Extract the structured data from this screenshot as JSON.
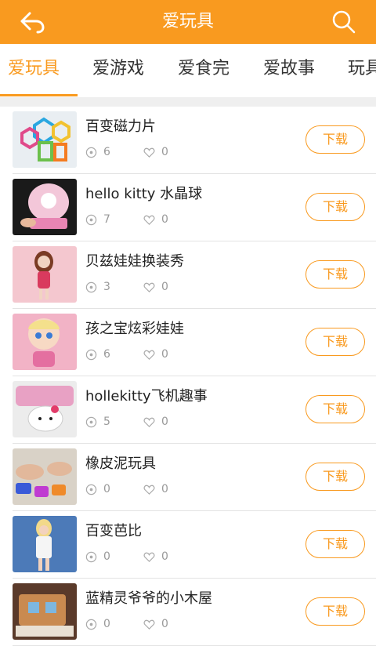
{
  "header": {
    "title": "爱玩具",
    "back_icon": "back-arrow-icon",
    "search_icon": "search-icon"
  },
  "accent_color": "#f99a1f",
  "tabs": [
    {
      "label": "爱玩具",
      "active": true
    },
    {
      "label": "爱游戏",
      "active": false
    },
    {
      "label": "爱食完",
      "active": false
    },
    {
      "label": "爱故事",
      "active": false
    },
    {
      "label": "玩具",
      "active": false
    }
  ],
  "list": [
    {
      "title": "百变磁力片",
      "views": "6",
      "likes": "0",
      "button": "下载"
    },
    {
      "title": "hello kitty  水晶球",
      "views": "7",
      "likes": "0",
      "button": "下载"
    },
    {
      "title": "贝兹娃娃换装秀",
      "views": "3",
      "likes": "0",
      "button": "下载"
    },
    {
      "title": "孩之宝炫彩娃娃",
      "views": "6",
      "likes": "0",
      "button": "下载"
    },
    {
      "title": "hollekitty飞机趣事",
      "views": "5",
      "likes": "0",
      "button": "下载"
    },
    {
      "title": "橡皮泥玩具",
      "views": "0",
      "likes": "0",
      "button": "下载"
    },
    {
      "title": "百变芭比",
      "views": "0",
      "likes": "0",
      "button": "下载"
    },
    {
      "title": "蓝精灵爷爷的小木屋",
      "views": "0",
      "likes": "0",
      "button": "下载"
    }
  ]
}
